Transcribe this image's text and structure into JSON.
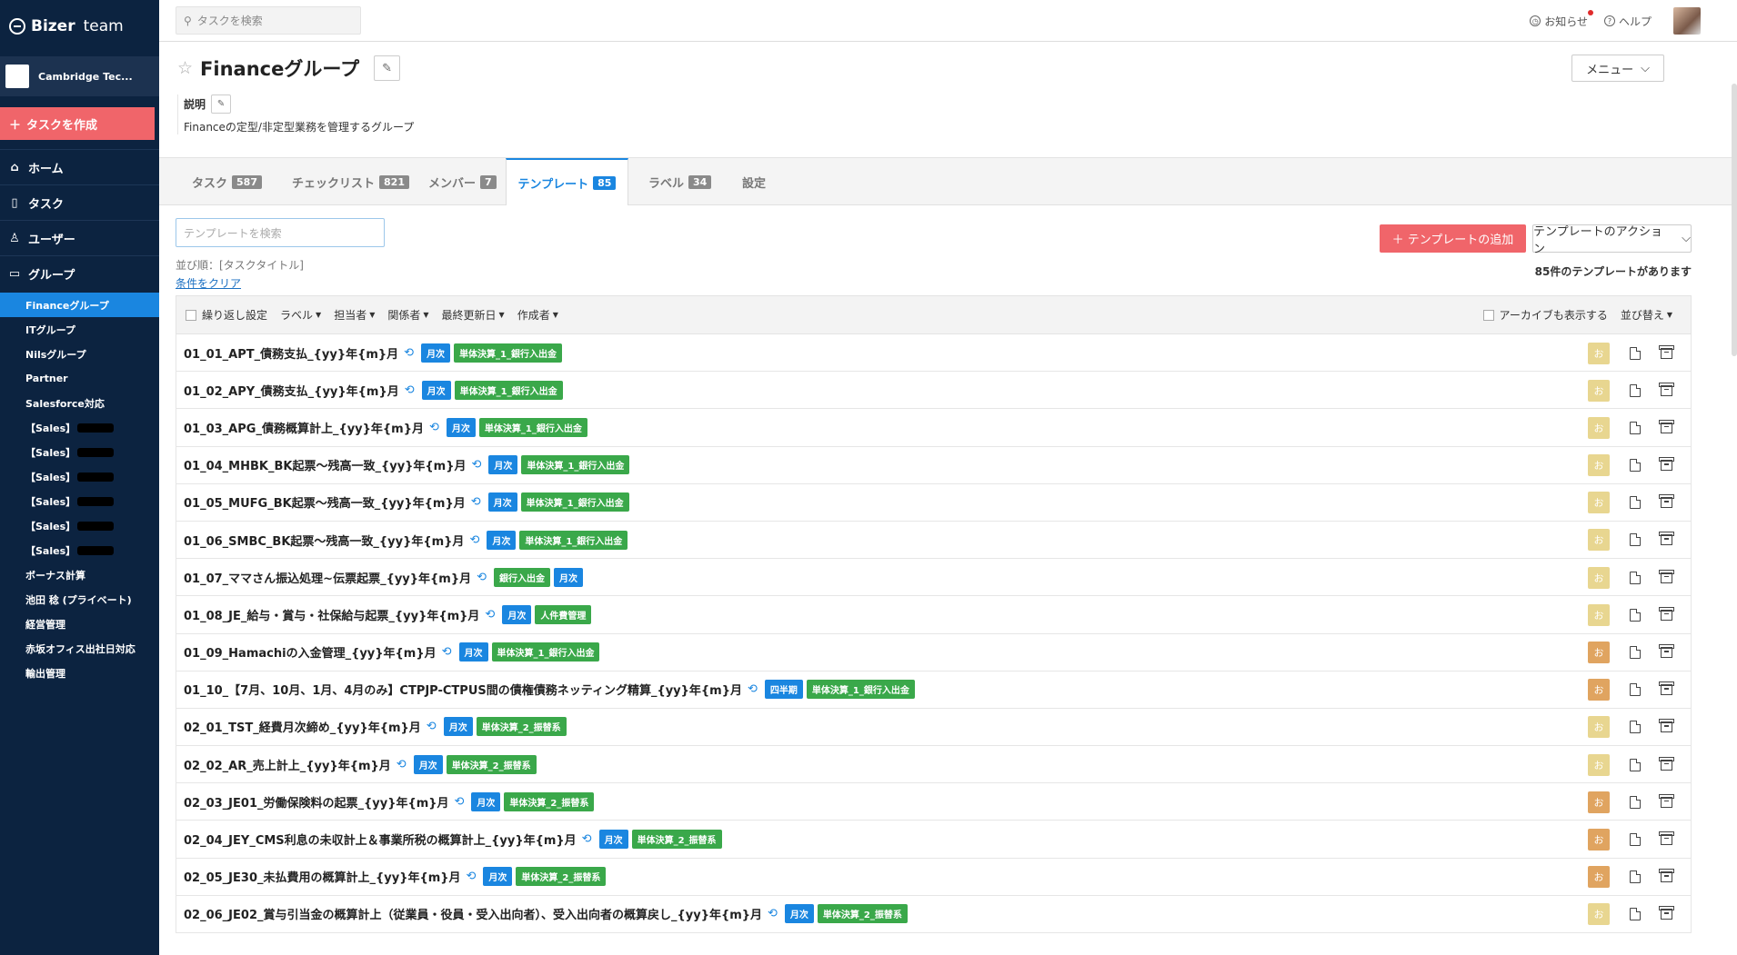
{
  "app": {
    "logo_main": "Bizer",
    "logo_sub": "team"
  },
  "workspace": {
    "name": "Cambridge Tec..."
  },
  "sidebar": {
    "create_task": "タスクを作成",
    "nav": [
      {
        "label": "ホーム",
        "icon": "home-icon"
      },
      {
        "label": "タスク",
        "icon": "document-icon"
      },
      {
        "label": "ユーザー",
        "icon": "user-icon"
      },
      {
        "label": "グループ",
        "icon": "folder-icon"
      }
    ],
    "groups": [
      {
        "label": "Financeグループ",
        "active": true
      },
      {
        "label": "ITグループ"
      },
      {
        "label": "Nilsグループ"
      },
      {
        "label": "Partner"
      },
      {
        "label": "Salesforce対応"
      },
      {
        "label": "【Sales】",
        "redacted": true
      },
      {
        "label": "【Sales】",
        "redacted": true
      },
      {
        "label": "【Sales】",
        "redacted": true
      },
      {
        "label": "【Sales】",
        "redacted": true
      },
      {
        "label": "【Sales】",
        "redacted": true
      },
      {
        "label": "【Sales】",
        "redacted": true
      },
      {
        "label": "ボーナス計算"
      },
      {
        "label": "池田 稔 (プライベート)"
      },
      {
        "label": "経営管理"
      },
      {
        "label": "赤坂オフィス出社日対応"
      },
      {
        "label": "輸出管理"
      }
    ]
  },
  "topbar": {
    "search_placeholder": "タスクを検索",
    "notifications": "お知らせ",
    "help": "ヘルプ"
  },
  "page": {
    "title": "Financeグループ",
    "menu": "メニュー",
    "desc_label": "説明",
    "description": "Financeの定型/非定型業務を管理するグループ"
  },
  "tabs": [
    {
      "label": "タスク",
      "count": "587"
    },
    {
      "label": "チェックリスト",
      "count": "821"
    },
    {
      "label": "メンバー",
      "count": "7"
    },
    {
      "label": "テンプレート",
      "count": "85",
      "active": true
    },
    {
      "label": "ラベル",
      "count": "34"
    },
    {
      "label": "設定",
      "count": ""
    }
  ],
  "templates": {
    "search_placeholder": "テンプレートを検索",
    "sort_text": "並び順：[タスクタイトル]",
    "clear": "条件をクリア",
    "add_button": "テンプレートの追加",
    "action_button": "テンプレートのアクション",
    "count_text": "85件のテンプレートがあります",
    "filters": {
      "repeat": "繰り返し設定",
      "label": "ラベル",
      "assignee": "担当者",
      "related": "関係者",
      "updated": "最終更新日",
      "author": "作成者",
      "archive": "アーカイブも表示する",
      "sort": "並び替え"
    },
    "assignee_initial": "お",
    "colors": {
      "light": "#e8d690",
      "orange": "#e0a460",
      "blue": "#1a86e0",
      "green": "#3aa84a",
      "red": "#f0656a"
    },
    "rows": [
      {
        "title": "01_01_APT_債務支払_{yy}年{m}月",
        "tags": [
          [
            "月次",
            "blue"
          ],
          [
            "単体決算_1_銀行入出金",
            "green"
          ]
        ],
        "av": "light"
      },
      {
        "title": "01_02_APY_債務支払_{yy}年{m}月",
        "tags": [
          [
            "月次",
            "blue"
          ],
          [
            "単体決算_1_銀行入出金",
            "green"
          ]
        ],
        "av": "light"
      },
      {
        "title": "01_03_APG_債務概算計上_{yy}年{m}月",
        "tags": [
          [
            "月次",
            "blue"
          ],
          [
            "単体決算_1_銀行入出金",
            "green"
          ]
        ],
        "av": "light"
      },
      {
        "title": "01_04_MHBK_BK起票～残高一致_{yy}年{m}月",
        "tags": [
          [
            "月次",
            "blue"
          ],
          [
            "単体決算_1_銀行入出金",
            "green"
          ]
        ],
        "av": "light"
      },
      {
        "title": "01_05_MUFG_BK起票～残高一致_{yy}年{m}月",
        "tags": [
          [
            "月次",
            "blue"
          ],
          [
            "単体決算_1_銀行入出金",
            "green"
          ]
        ],
        "av": "light"
      },
      {
        "title": "01_06_SMBC_BK起票～残高一致_{yy}年{m}月",
        "tags": [
          [
            "月次",
            "blue"
          ],
          [
            "単体決算_1_銀行入出金",
            "green"
          ]
        ],
        "av": "light"
      },
      {
        "title": "01_07_ママさん振込処理~伝票起票_{yy}年{m}月",
        "tags": [
          [
            "銀行入出金",
            "green"
          ],
          [
            "月次",
            "blue"
          ]
        ],
        "av": "light"
      },
      {
        "title": "01_08_JE_給与・賞与・社保給与起票_{yy}年{m}月",
        "tags": [
          [
            "月次",
            "blue"
          ],
          [
            "人件費管理",
            "green"
          ]
        ],
        "av": "light"
      },
      {
        "title": "01_09_Hamachiの入金管理_{yy}年{m}月",
        "tags": [
          [
            "月次",
            "blue"
          ],
          [
            "単体決算_1_銀行入出金",
            "green"
          ]
        ],
        "av": "orange"
      },
      {
        "title": "01_10_【7月、10月、1月、4月のみ】CTPJP-CTPUS間の債権債務ネッティング精算_{yy}年{m}月",
        "tags": [
          [
            "四半期",
            "blue"
          ],
          [
            "単体決算_1_銀行入出金",
            "green"
          ]
        ],
        "av": "orange"
      },
      {
        "title": "02_01_TST_経費月次締め_{yy}年{m}月",
        "tags": [
          [
            "月次",
            "blue"
          ],
          [
            "単体決算_2_振替系",
            "green"
          ]
        ],
        "av": "light"
      },
      {
        "title": "02_02_AR_売上計上_{yy}年{m}月",
        "tags": [
          [
            "月次",
            "blue"
          ],
          [
            "単体決算_2_振替系",
            "green"
          ]
        ],
        "av": "light"
      },
      {
        "title": "02_03_JE01_労働保険料の起票_{yy}年{m}月",
        "tags": [
          [
            "月次",
            "blue"
          ],
          [
            "単体決算_2_振替系",
            "green"
          ]
        ],
        "av": "orange"
      },
      {
        "title": "02_04_JEY_CMS利息の未収計上＆事業所税の概算計上_{yy}年{m}月",
        "tags": [
          [
            "月次",
            "blue"
          ],
          [
            "単体決算_2_振替系",
            "green"
          ]
        ],
        "av": "orange"
      },
      {
        "title": "02_05_JE30_未払費用の概算計上_{yy}年{m}月",
        "tags": [
          [
            "月次",
            "blue"
          ],
          [
            "単体決算_2_振替系",
            "green"
          ]
        ],
        "av": "orange"
      },
      {
        "title": "02_06_JE02_賞与引当金の概算計上（従業員・役員・受入出向者）、受入出向者の概算戻し_{yy}年{m}月",
        "tags": [
          [
            "月次",
            "blue"
          ],
          [
            "単体決算_2_振替系",
            "green"
          ]
        ],
        "av": "light"
      }
    ]
  }
}
